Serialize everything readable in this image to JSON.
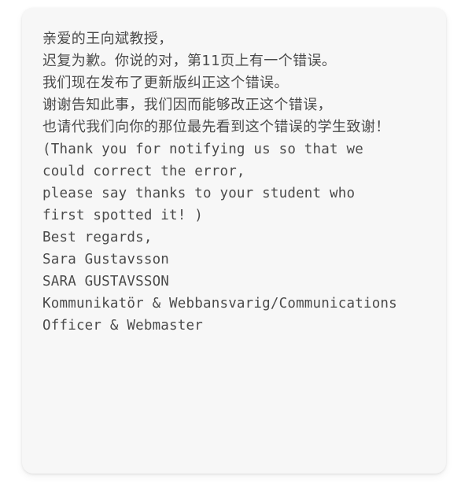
{
  "card": {
    "background_color": "#f7f7f7",
    "page_background_color": "#ffffff",
    "text_color": "#4a4a4a"
  },
  "message": {
    "lines": [
      {
        "text": "亲爱的王向斌教授，",
        "script": "cjk"
      },
      {
        "text": "迟复为歉。你说的对，第11页上有一个错误。",
        "script": "cjk"
      },
      {
        "text": "我们现在发布了更新版纠正这个错误。",
        "script": "cjk"
      },
      {
        "text": "谢谢告知此事，我们因而能够改正这个错误，",
        "script": "cjk"
      },
      {
        "text": "也请代我们向你的那位最先看到这个错误的学生致谢！",
        "script": "cjk"
      },
      {
        "text": "(Thank you for notifying us so that we",
        "script": "latin"
      },
      {
        "text": "could correct the error,",
        "script": "latin"
      },
      {
        "text": "please say thanks to your student who",
        "script": "latin"
      },
      {
        "text": "first spotted it! )",
        "script": "latin"
      },
      {
        "text": "Best regards,",
        "script": "latin"
      },
      {
        "text": "Sara Gustavsson",
        "script": "latin"
      },
      {
        "text": "SARA GUSTAVSSON",
        "script": "latin"
      },
      {
        "text": "Kommunikatör & Webbansvarig/Communications",
        "script": "latin"
      },
      {
        "text": "Officer & Webmaster",
        "script": "latin"
      }
    ]
  }
}
